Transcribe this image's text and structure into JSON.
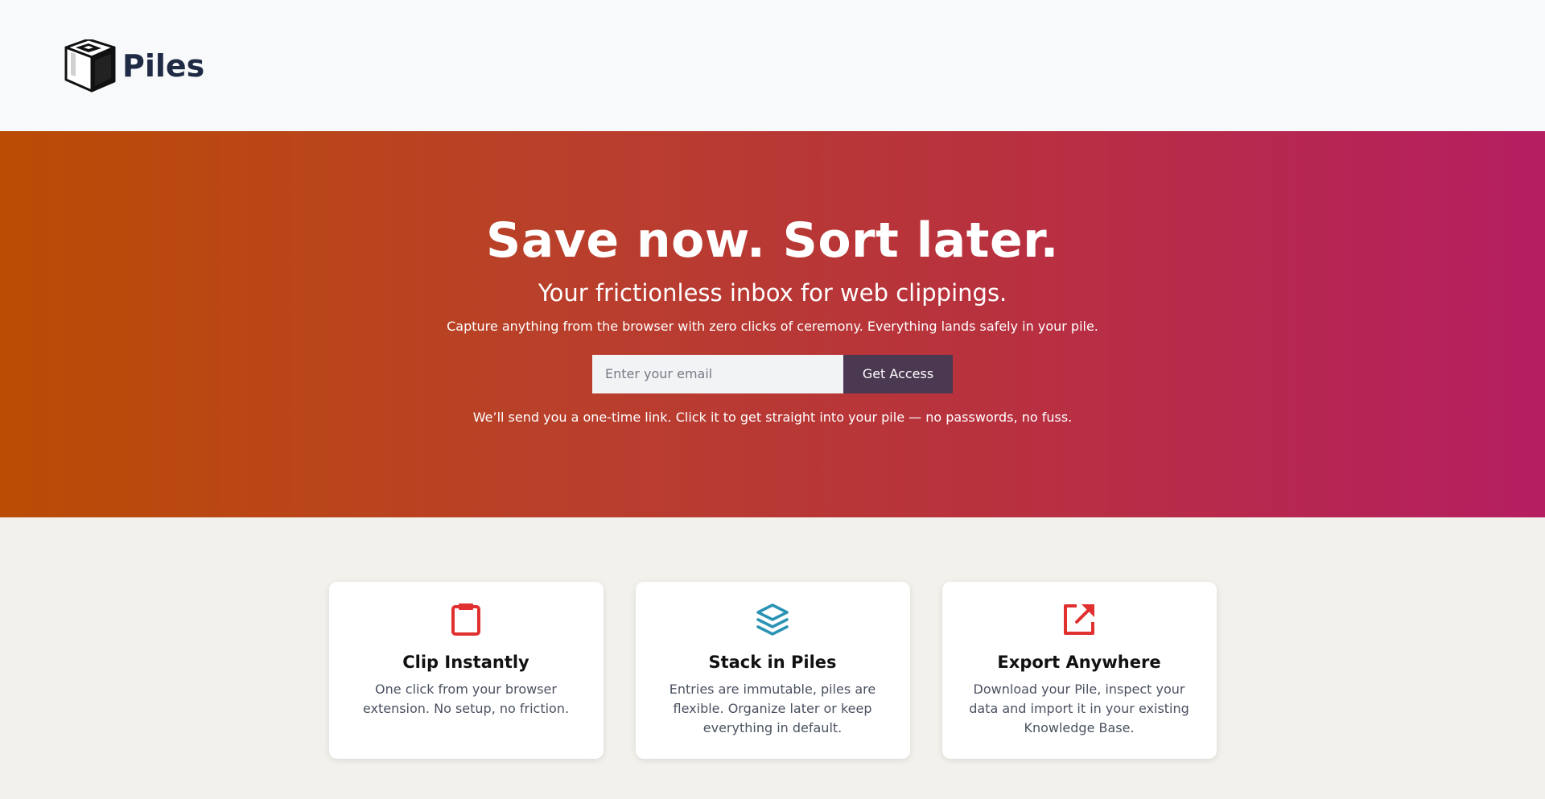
{
  "header": {
    "brand_name": "Piles",
    "logo_icon": "cube-logo-icon"
  },
  "hero": {
    "title": "Save now. Sort later.",
    "subtitle": "Your frictionless inbox for web clippings.",
    "description": "Capture anything from the browser with zero clicks of ceremony. Everything lands safely in your pile.",
    "email_placeholder": "Enter your email",
    "email_value": "",
    "button_label": "Get Access",
    "note": "We’ll send you a one-time link. Click it to get straight into your pile — no passwords, no fuss.",
    "gradient_colors": [
      "#ba4c04",
      "#b9402a",
      "#b8313f",
      "#b51e61"
    ],
    "button_color": "#4b3952"
  },
  "features": [
    {
      "icon": "clipboard-icon",
      "icon_color": "#e0302f",
      "title": "Clip Instantly",
      "text": "One click from your browser extension. No setup, no friction."
    },
    {
      "icon": "layers-icon",
      "icon_color": "#2a93b3",
      "title": "Stack in Piles",
      "text": "Entries are immutable, piles are flexible. Organize later or keep everything in default."
    },
    {
      "icon": "external-link-icon",
      "icon_color": "#e0302f",
      "title": "Export Anywhere",
      "text": "Download your Pile, inspect your data and import it in your existing Knowledge Base."
    }
  ]
}
